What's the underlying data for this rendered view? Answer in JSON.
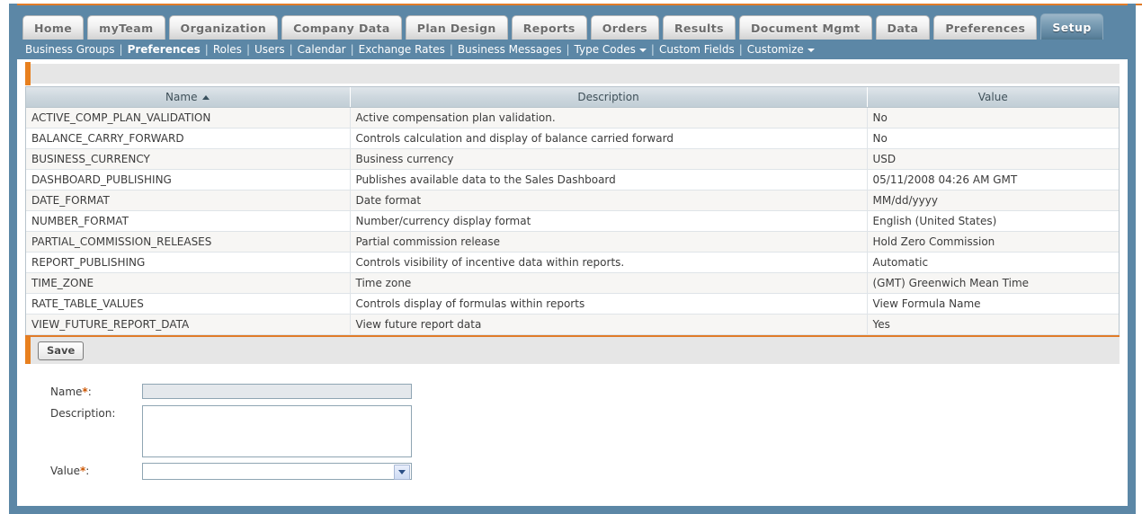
{
  "colors": {
    "accent_orange": "#e07b28",
    "frame_blue": "#5c87a6",
    "header_blue": "#c2ced6",
    "row_alt": "#f7f6f4"
  },
  "main_tabs": [
    {
      "label": "Home",
      "active": false
    },
    {
      "label": "myTeam",
      "active": false
    },
    {
      "label": "Organization",
      "active": false
    },
    {
      "label": "Company Data",
      "active": false
    },
    {
      "label": "Plan Design",
      "active": false
    },
    {
      "label": "Reports",
      "active": false
    },
    {
      "label": "Orders",
      "active": false
    },
    {
      "label": "Results",
      "active": false
    },
    {
      "label": "Document Mgmt",
      "active": false
    },
    {
      "label": "Data",
      "active": false
    },
    {
      "label": "Preferences",
      "active": false
    },
    {
      "label": "Setup",
      "active": true
    }
  ],
  "subnav": [
    {
      "label": "Business Groups",
      "current": false,
      "caret": false
    },
    {
      "label": "Preferences",
      "current": true,
      "caret": false
    },
    {
      "label": "Roles",
      "current": false,
      "caret": false
    },
    {
      "label": "Users",
      "current": false,
      "caret": false
    },
    {
      "label": "Calendar",
      "current": false,
      "caret": false
    },
    {
      "label": "Exchange Rates",
      "current": false,
      "caret": false
    },
    {
      "label": "Business Messages",
      "current": false,
      "caret": false
    },
    {
      "label": "Type Codes",
      "current": false,
      "caret": true
    },
    {
      "label": "Custom Fields",
      "current": false,
      "caret": false
    },
    {
      "label": "Customize",
      "current": false,
      "caret": true
    }
  ],
  "table": {
    "sort_column": "Name",
    "sort_direction": "asc",
    "columns": [
      {
        "label": "Name",
        "sorted": true
      },
      {
        "label": "Description",
        "sorted": false
      },
      {
        "label": "Value",
        "sorted": false
      }
    ],
    "rows": [
      {
        "name": "ACTIVE_COMP_PLAN_VALIDATION",
        "description": "Active compensation plan validation.",
        "value": "No"
      },
      {
        "name": "BALANCE_CARRY_FORWARD",
        "description": "Controls calculation and display of balance carried forward",
        "value": "No"
      },
      {
        "name": "BUSINESS_CURRENCY",
        "description": "Business currency",
        "value": "USD"
      },
      {
        "name": "DASHBOARD_PUBLISHING",
        "description": "Publishes available data to the Sales Dashboard",
        "value": "05/11/2008 04:26 AM GMT"
      },
      {
        "name": "DATE_FORMAT",
        "description": "Date format",
        "value": "MM/dd/yyyy"
      },
      {
        "name": "NUMBER_FORMAT",
        "description": "Number/currency display format",
        "value": "English (United States)"
      },
      {
        "name": "PARTIAL_COMMISSION_RELEASES",
        "description": "Partial commission release",
        "value": "Hold Zero Commission"
      },
      {
        "name": "REPORT_PUBLISHING",
        "description": "Controls visibility of incentive data within reports.",
        "value": "Automatic"
      },
      {
        "name": "TIME_ZONE",
        "description": "Time zone",
        "value": "(GMT) Greenwich Mean Time"
      },
      {
        "name": "RATE_TABLE_VALUES",
        "description": "Controls display of formulas within reports",
        "value": "View Formula Name"
      },
      {
        "name": "VIEW_FUTURE_REPORT_DATA",
        "description": "View future report data",
        "value": "Yes"
      }
    ]
  },
  "toolbar": {
    "save_label": "Save"
  },
  "form": {
    "name": {
      "label": "Name",
      "required_marker": "*",
      "colon": ":",
      "value": ""
    },
    "description": {
      "label": "Description",
      "required_marker": "",
      "colon": ":",
      "value": ""
    },
    "value": {
      "label": "Value",
      "required_marker": "*",
      "colon": ":",
      "selected": "",
      "options": [
        ""
      ]
    }
  }
}
